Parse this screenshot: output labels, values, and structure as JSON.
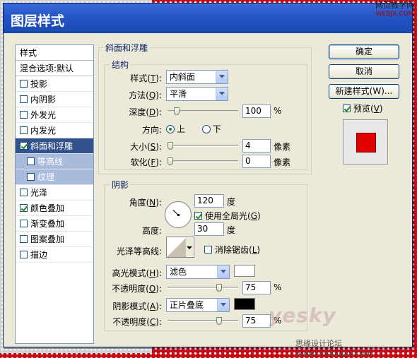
{
  "dialog": {
    "title": "图层样式"
  },
  "watermark": {
    "top_line1": "网页教学网",
    "top_line2": "WEBJX.COM",
    "bottom_brand": "yesky",
    "bottom_line": "思缘设计论坛  www.missyuan.com"
  },
  "style_list": {
    "header": "样式",
    "blend_options": "混合选项:默认",
    "items": [
      {
        "label": "投影",
        "checked": false
      },
      {
        "label": "内阴影",
        "checked": false
      },
      {
        "label": "外发光",
        "checked": false
      },
      {
        "label": "内发光",
        "checked": false
      },
      {
        "label": "斜面和浮雕",
        "checked": true,
        "selected": true
      },
      {
        "label": "等高线",
        "checked": false,
        "sub": true
      },
      {
        "label": "纹理",
        "checked": false,
        "sub": true
      },
      {
        "label": "光泽",
        "checked": false
      },
      {
        "label": "颜色叠加",
        "checked": true
      },
      {
        "label": "渐变叠加",
        "checked": false
      },
      {
        "label": "图案叠加",
        "checked": false
      },
      {
        "label": "描边",
        "checked": false
      }
    ]
  },
  "bevel": {
    "section_title": "斜面和浮雕",
    "structure_title": "结构",
    "style_label": "样式(",
    "style_key": "T",
    "style_value": "内斜面",
    "technique_label": "方法(",
    "technique_key": "Q",
    "technique_value": "平滑",
    "depth_label": "深度(",
    "depth_key": "D",
    "depth_value": "100",
    "depth_unit": "%",
    "depth_slider": 0.1,
    "direction_label": "方向:",
    "direction_up": "上",
    "direction_down": "下",
    "direction_selected": "上",
    "size_label": "大小(",
    "size_key": "S",
    "size_value": "4",
    "size_unit": "像素",
    "size_slider": 0.0,
    "soften_label": "软化(",
    "soften_key": "F",
    "soften_value": "0",
    "soften_unit": "像素",
    "soften_slider": 0.0
  },
  "shading": {
    "section_title": "阴影",
    "angle_label": "角度(",
    "angle_key": "N",
    "angle_value": "120",
    "angle_unit": "度",
    "global_light_label": "使用全局光(",
    "global_light_key": "G",
    "global_light_checked": true,
    "altitude_label": "高度:",
    "altitude_value": "30",
    "altitude_unit": "度",
    "gloss_contour_label": "光泽等高线:",
    "anti_alias_label": "消除锯齿(",
    "anti_alias_key": "L",
    "anti_alias_checked": false,
    "highlight_mode_label": "高光模式(",
    "highlight_mode_key": "H",
    "highlight_mode_value": "滤色",
    "highlight_color": "#ffffff",
    "highlight_opacity_label": "不透明度(",
    "highlight_opacity_key": "O",
    "highlight_opacity_value": "75",
    "highlight_opacity_unit": "%",
    "highlight_opacity_slider": 0.75,
    "shadow_mode_label": "阴影模式(",
    "shadow_mode_key": "A",
    "shadow_mode_value": "正片叠底",
    "shadow_color": "#000000",
    "shadow_opacity_label": "不透明度(",
    "shadow_opacity_key": "C",
    "shadow_opacity_value": "75",
    "shadow_opacity_unit": "%",
    "shadow_opacity_slider": 0.75
  },
  "buttons": {
    "ok": "确定",
    "cancel": "取消",
    "new_style": "新建样式(W)...",
    "preview_label": "预览(",
    "preview_key": "V",
    "preview_checked": true
  },
  "colors": {
    "title_bar": "#2456c6",
    "selected_item": "#31528c",
    "preview_swatch": "#e10000"
  }
}
